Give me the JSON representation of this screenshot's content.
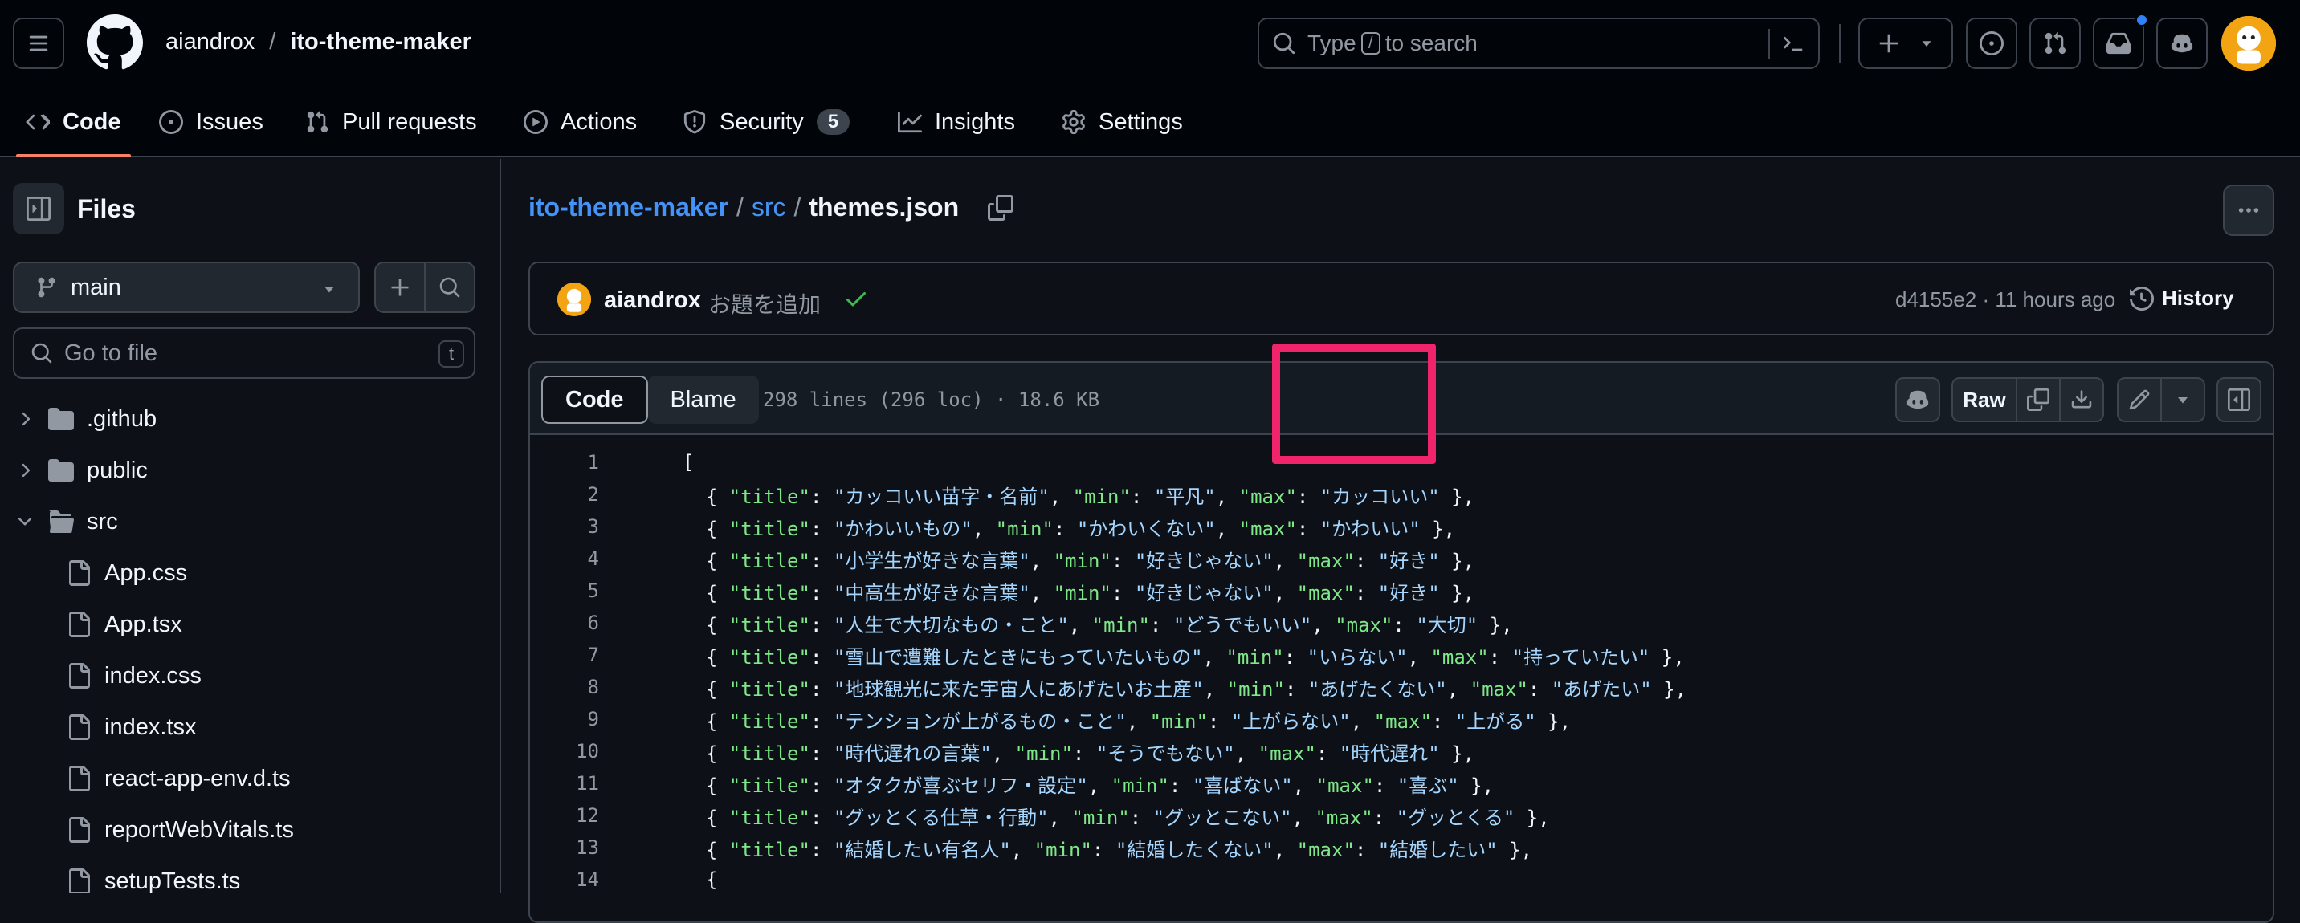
{
  "header": {
    "owner": "aiandrox",
    "repo": "ito-theme-maker",
    "search": {
      "prefix": "Type",
      "key": "/",
      "suffix": "to search"
    }
  },
  "repo_tabs": [
    {
      "label": "Code",
      "icon": "code-icon"
    },
    {
      "label": "Issues",
      "icon": "issue-icon"
    },
    {
      "label": "Pull requests",
      "icon": "pull-request-icon"
    },
    {
      "label": "Actions",
      "icon": "play-icon"
    },
    {
      "label": "Security",
      "icon": "shield-icon",
      "count": "5"
    },
    {
      "label": "Insights",
      "icon": "graph-icon"
    },
    {
      "label": "Settings",
      "icon": "gear-icon"
    }
  ],
  "sidebar": {
    "title": "Files",
    "branch": "main",
    "goto_placeholder": "Go to file",
    "goto_key": "t",
    "tree": [
      {
        "name": ".github",
        "type": "folder",
        "expanded": false
      },
      {
        "name": "public",
        "type": "folder",
        "expanded": false
      },
      {
        "name": "src",
        "type": "folder",
        "expanded": true
      },
      {
        "name": "App.css",
        "type": "file"
      },
      {
        "name": "App.tsx",
        "type": "file"
      },
      {
        "name": "index.css",
        "type": "file"
      },
      {
        "name": "index.tsx",
        "type": "file"
      },
      {
        "name": "react-app-env.d.ts",
        "type": "file"
      },
      {
        "name": "reportWebVitals.ts",
        "type": "file"
      },
      {
        "name": "setupTests.ts",
        "type": "file"
      }
    ]
  },
  "breadcrumb": {
    "repo": "ito-theme-maker",
    "dir": "src",
    "file": "themes.json"
  },
  "commit": {
    "author": "aiandrox",
    "message": "お題を追加",
    "sha": "d4155e2",
    "time": "11 hours ago",
    "history_label": "History"
  },
  "file": {
    "tabs": [
      "Code",
      "Blame"
    ],
    "info": "298 lines (296 loc) · 18.6 KB",
    "raw_label": "Raw"
  },
  "code_lines": [
    {
      "n": "1",
      "text": "["
    },
    {
      "n": "2",
      "title": "カッコいい苗字・名前",
      "min": "平凡",
      "max": "カッコいい"
    },
    {
      "n": "3",
      "title": "かわいいもの",
      "min": "かわいくない",
      "max": "かわいい"
    },
    {
      "n": "4",
      "title": "小学生が好きな言葉",
      "min": "好きじゃない",
      "max": "好き"
    },
    {
      "n": "5",
      "title": "中高生が好きな言葉",
      "min": "好きじゃない",
      "max": "好き"
    },
    {
      "n": "6",
      "title": "人生で大切なもの・こと",
      "min": "どうでもいい",
      "max": "大切"
    },
    {
      "n": "7",
      "title": "雪山で遭難したときにもっていたいもの",
      "min": "いらない",
      "max": "持っていたい"
    },
    {
      "n": "8",
      "title": "地球観光に来た宇宙人にあげたいお土産",
      "min": "あげたくない",
      "max": "あげたい"
    },
    {
      "n": "9",
      "title": "テンションが上がるもの・こと",
      "min": "上がらない",
      "max": "上がる"
    },
    {
      "n": "10",
      "title": "時代遅れの言葉",
      "min": "そうでもない",
      "max": "時代遅れ"
    },
    {
      "n": "11",
      "title": "オタクが喜ぶセリフ・設定",
      "min": "喜ばない",
      "max": "喜ぶ"
    },
    {
      "n": "12",
      "title": "グッとくる仕草・行動",
      "min": "グッとこない",
      "max": "グッとくる"
    },
    {
      "n": "13",
      "title": "結婚したい有名人",
      "min": "結婚したくない",
      "max": "結婚したい"
    },
    {
      "n": "14",
      "text": "  {"
    }
  ],
  "colors": {
    "background": "#0d1117",
    "header_bg": "#010409",
    "accent_link": "#4493f8",
    "tab_underline": "#f78166",
    "json_key": "#7ee787",
    "json_string": "#a5d6ff",
    "highlight_annotation": "#f0246b",
    "success_check": "#3fb950"
  }
}
